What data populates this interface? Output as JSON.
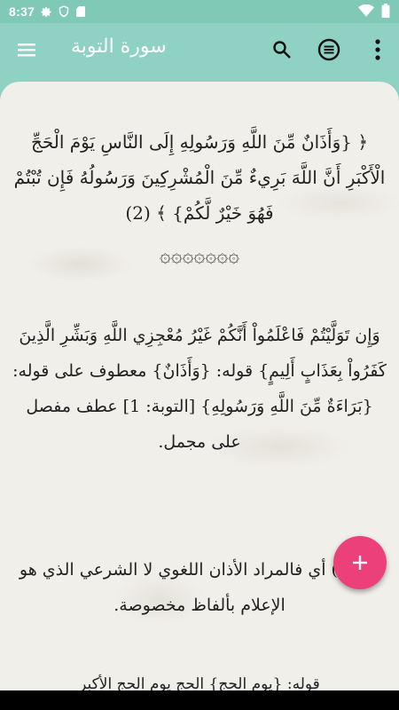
{
  "status_bar": {
    "time": "8:37",
    "icons": [
      "gear-icon",
      "shield-icon",
      "sd-card-icon",
      "wifi-icon",
      "battery-icon"
    ]
  },
  "app_bar": {
    "title": "سورة التوبة",
    "icons": [
      "menu-icon",
      "search-icon",
      "list-icon",
      "more-vert-icon"
    ]
  },
  "content": {
    "verse": "﴿ {وَأَذَانٌ مِّنَ اللَّهِ وَرَسُولِهِ إِلَى النَّاسِ يَوْمَ الْحَجِّ الْأَكْبَرِ أَنَّ اللَّهَ بَرِيءٌ مِّنَ الْمُشْرِكِينَ وَرَسُولُهُ فَإِن تُبْتُمْ فَهُوَ خَيْرٌ لَّكُمْ} ﴾ (2)",
    "ornament": "۞۞۞۞۞۞۞",
    "tafsir_1": "وَإِن تَوَلَّيْتُمْ فَاعْلَمُواْ أَنَّكُمْ غَيْرُ مُعْجِزِي اللَّهِ وَبَشِّرِ الَّذِينَ كَفَرُواْ بِعَذَابٍ أَلِيمٍ} قوله: {وَأَذَانٌ} معطوف على قوله: {بَرَاءَةٌ مِّنَ اللَّهِ وَرَسُولِهِ} [التوبة: 1] عطف مفصل على مجمل.",
    "tafsir_2": "(اعلام) أي فالمراد الأذان اللغوي لا الشرعي الذي هو الإعلام بألفاظ مخصوصة.",
    "tafsir_3": "قوله: {يوم الحج} الحج يوم الحج الأكبر"
  },
  "fab": {
    "label": "+"
  },
  "colors": {
    "primary": "#8fd1c2",
    "accent": "#ec407a",
    "paper": "#f1efe9"
  }
}
